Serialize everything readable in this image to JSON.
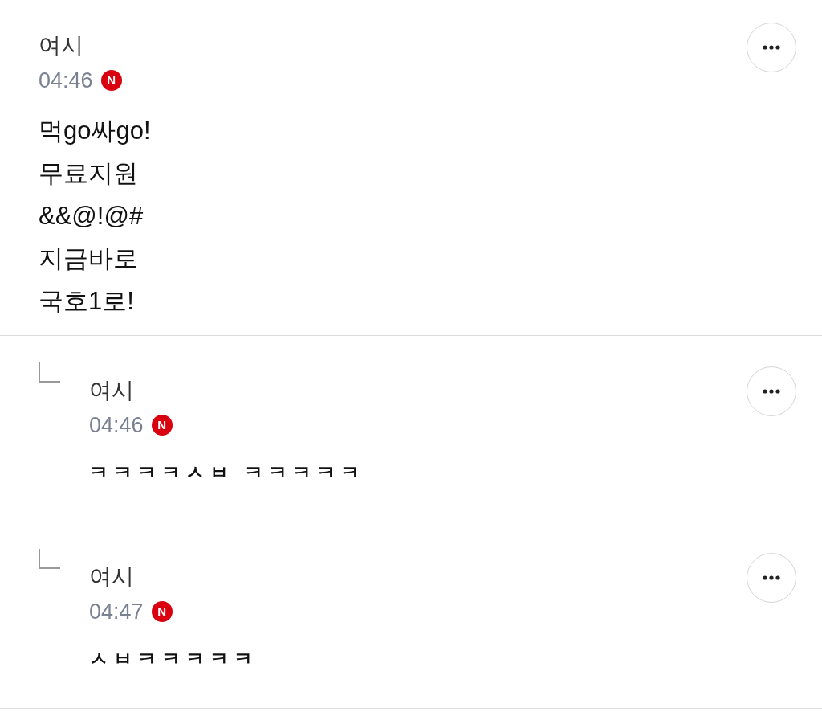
{
  "comments": [
    {
      "kind": "comment",
      "author": "여시",
      "time": "04:46",
      "badge": "N",
      "body": "먹go싸go!\n무료지원\n&&@!@#\n지금바로\n국호1로!"
    },
    {
      "kind": "reply",
      "author": "여시",
      "time": "04:46",
      "badge": "N",
      "body": "ㅋㅋㅋㅋㅅㅂ ㅋㅋㅋㅋㅋ"
    },
    {
      "kind": "reply",
      "author": "여시",
      "time": "04:47",
      "badge": "N",
      "body": "ㅅㅂㅋㅋㅋㅋㅋ"
    }
  ]
}
